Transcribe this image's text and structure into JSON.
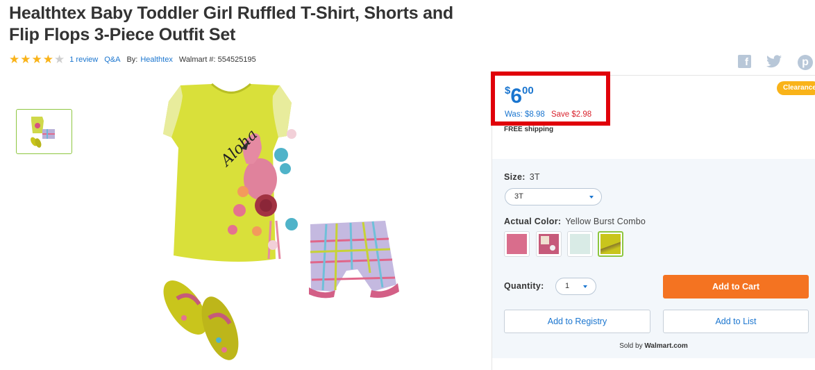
{
  "product": {
    "title": "Healthtex Baby Toddler Girl Ruffled T-Shirt, Shorts and Flip Flops 3-Piece Outfit Set",
    "rating": 4,
    "max_rating": 5,
    "review_link": "1 review",
    "qa_link": "Q&A",
    "by_label": "By:",
    "brand": "Healthtex",
    "walmart_number": "Walmart #: 554525195"
  },
  "social": {
    "facebook_icon": "facebook-icon",
    "twitter_icon": "twitter-icon",
    "pinterest_icon": "pinterest-icon"
  },
  "price": {
    "currency": "$",
    "dollars": "6",
    "cents": "00",
    "was": "Was: $8.98",
    "save": "Save $2.98",
    "shipping": "FREE shipping",
    "badge": "Clearance"
  },
  "options": {
    "size_label": "Size:",
    "size_value": "3T",
    "size_selected": "3T",
    "color_label": "Actual Color:",
    "color_value": "Yellow Burst Combo",
    "swatches": [
      {
        "name": "pink",
        "color": "#d96d8c"
      },
      {
        "name": "pink-floral",
        "color": "#c65a7a"
      },
      {
        "name": "mint",
        "color": "#d9ebe6"
      },
      {
        "name": "yellow-burst-combo",
        "color": "#c9c51c"
      }
    ],
    "selected_swatch": "yellow-burst-combo",
    "quantity_label": "Quantity:",
    "quantity_value": "1"
  },
  "actions": {
    "add_to_cart": "Add to Cart",
    "add_to_registry": "Add to Registry",
    "add_to_list": "Add to List",
    "sold_by_prefix": "Sold by",
    "seller": "Walmart.com"
  },
  "colors": {
    "link_blue": "#1a75cf",
    "cart_orange": "#f47321",
    "save_red": "#d9232d",
    "highlight_red": "#e0000a",
    "star_gold": "#f9b319",
    "selected_green": "#8dc63f"
  }
}
